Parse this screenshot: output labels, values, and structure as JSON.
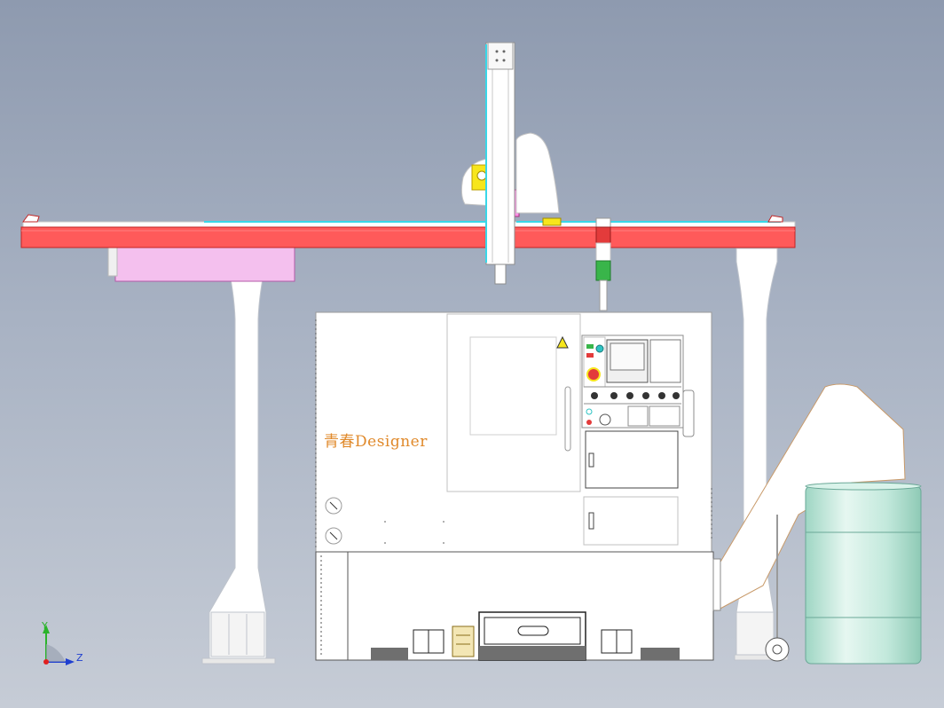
{
  "watermark": {
    "text": "青春Designer"
  },
  "triad": {
    "y_label": "Y",
    "z_label": "Z"
  },
  "colors": {
    "background_top": "#8e9aaf",
    "background_bottom": "#c6ccd6",
    "gantry_beam": "#ff5a5a",
    "pink_box": "#f4c0ee",
    "watermark": "#e0892a",
    "beacon_green": "#39b54a",
    "beacon_red": "#e33b3b",
    "warning_yellow": "#f7e61c",
    "barrel": "#c8ecdf"
  }
}
